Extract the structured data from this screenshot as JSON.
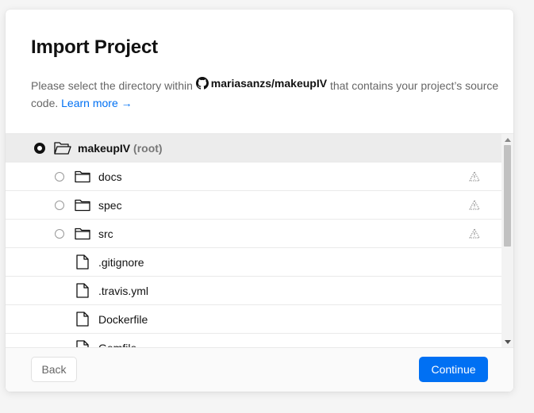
{
  "dialog": {
    "title": "Import Project",
    "description_prefix": "Please select the directory within",
    "repo": "mariasanzs/makeupIV",
    "description_suffix": "that contains your project’s source code.",
    "learn_more": "Learn more →"
  },
  "tree": {
    "root": {
      "name": "makeupIV",
      "suffix": "(root)",
      "selected": true
    },
    "folders": [
      {
        "name": "docs"
      },
      {
        "name": "spec"
      },
      {
        "name": "src"
      }
    ],
    "files": [
      {
        "name": ".gitignore"
      },
      {
        "name": ".travis.yml"
      },
      {
        "name": "Dockerfile"
      },
      {
        "name": "Gemfile"
      }
    ]
  },
  "footer": {
    "back_label": "Back",
    "continue_label": "Continue"
  },
  "colors": {
    "accent": "#0070f3",
    "selected_row": "#ececec"
  }
}
